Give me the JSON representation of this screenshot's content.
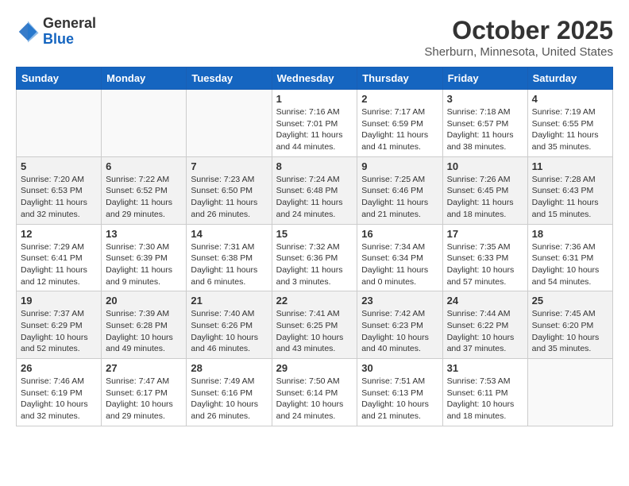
{
  "header": {
    "logo_general": "General",
    "logo_blue": "Blue",
    "month_title": "October 2025",
    "location": "Sherburn, Minnesota, United States"
  },
  "days_of_week": [
    "Sunday",
    "Monday",
    "Tuesday",
    "Wednesday",
    "Thursday",
    "Friday",
    "Saturday"
  ],
  "weeks": [
    [
      {
        "day": "",
        "info": ""
      },
      {
        "day": "",
        "info": ""
      },
      {
        "day": "",
        "info": ""
      },
      {
        "day": "1",
        "info": "Sunrise: 7:16 AM\nSunset: 7:01 PM\nDaylight: 11 hours and 44 minutes."
      },
      {
        "day": "2",
        "info": "Sunrise: 7:17 AM\nSunset: 6:59 PM\nDaylight: 11 hours and 41 minutes."
      },
      {
        "day": "3",
        "info": "Sunrise: 7:18 AM\nSunset: 6:57 PM\nDaylight: 11 hours and 38 minutes."
      },
      {
        "day": "4",
        "info": "Sunrise: 7:19 AM\nSunset: 6:55 PM\nDaylight: 11 hours and 35 minutes."
      }
    ],
    [
      {
        "day": "5",
        "info": "Sunrise: 7:20 AM\nSunset: 6:53 PM\nDaylight: 11 hours and 32 minutes."
      },
      {
        "day": "6",
        "info": "Sunrise: 7:22 AM\nSunset: 6:52 PM\nDaylight: 11 hours and 29 minutes."
      },
      {
        "day": "7",
        "info": "Sunrise: 7:23 AM\nSunset: 6:50 PM\nDaylight: 11 hours and 26 minutes."
      },
      {
        "day": "8",
        "info": "Sunrise: 7:24 AM\nSunset: 6:48 PM\nDaylight: 11 hours and 24 minutes."
      },
      {
        "day": "9",
        "info": "Sunrise: 7:25 AM\nSunset: 6:46 PM\nDaylight: 11 hours and 21 minutes."
      },
      {
        "day": "10",
        "info": "Sunrise: 7:26 AM\nSunset: 6:45 PM\nDaylight: 11 hours and 18 minutes."
      },
      {
        "day": "11",
        "info": "Sunrise: 7:28 AM\nSunset: 6:43 PM\nDaylight: 11 hours and 15 minutes."
      }
    ],
    [
      {
        "day": "12",
        "info": "Sunrise: 7:29 AM\nSunset: 6:41 PM\nDaylight: 11 hours and 12 minutes."
      },
      {
        "day": "13",
        "info": "Sunrise: 7:30 AM\nSunset: 6:39 PM\nDaylight: 11 hours and 9 minutes."
      },
      {
        "day": "14",
        "info": "Sunrise: 7:31 AM\nSunset: 6:38 PM\nDaylight: 11 hours and 6 minutes."
      },
      {
        "day": "15",
        "info": "Sunrise: 7:32 AM\nSunset: 6:36 PM\nDaylight: 11 hours and 3 minutes."
      },
      {
        "day": "16",
        "info": "Sunrise: 7:34 AM\nSunset: 6:34 PM\nDaylight: 11 hours and 0 minutes."
      },
      {
        "day": "17",
        "info": "Sunrise: 7:35 AM\nSunset: 6:33 PM\nDaylight: 10 hours and 57 minutes."
      },
      {
        "day": "18",
        "info": "Sunrise: 7:36 AM\nSunset: 6:31 PM\nDaylight: 10 hours and 54 minutes."
      }
    ],
    [
      {
        "day": "19",
        "info": "Sunrise: 7:37 AM\nSunset: 6:29 PM\nDaylight: 10 hours and 52 minutes."
      },
      {
        "day": "20",
        "info": "Sunrise: 7:39 AM\nSunset: 6:28 PM\nDaylight: 10 hours and 49 minutes."
      },
      {
        "day": "21",
        "info": "Sunrise: 7:40 AM\nSunset: 6:26 PM\nDaylight: 10 hours and 46 minutes."
      },
      {
        "day": "22",
        "info": "Sunrise: 7:41 AM\nSunset: 6:25 PM\nDaylight: 10 hours and 43 minutes."
      },
      {
        "day": "23",
        "info": "Sunrise: 7:42 AM\nSunset: 6:23 PM\nDaylight: 10 hours and 40 minutes."
      },
      {
        "day": "24",
        "info": "Sunrise: 7:44 AM\nSunset: 6:22 PM\nDaylight: 10 hours and 37 minutes."
      },
      {
        "day": "25",
        "info": "Sunrise: 7:45 AM\nSunset: 6:20 PM\nDaylight: 10 hours and 35 minutes."
      }
    ],
    [
      {
        "day": "26",
        "info": "Sunrise: 7:46 AM\nSunset: 6:19 PM\nDaylight: 10 hours and 32 minutes."
      },
      {
        "day": "27",
        "info": "Sunrise: 7:47 AM\nSunset: 6:17 PM\nDaylight: 10 hours and 29 minutes."
      },
      {
        "day": "28",
        "info": "Sunrise: 7:49 AM\nSunset: 6:16 PM\nDaylight: 10 hours and 26 minutes."
      },
      {
        "day": "29",
        "info": "Sunrise: 7:50 AM\nSunset: 6:14 PM\nDaylight: 10 hours and 24 minutes."
      },
      {
        "day": "30",
        "info": "Sunrise: 7:51 AM\nSunset: 6:13 PM\nDaylight: 10 hours and 21 minutes."
      },
      {
        "day": "31",
        "info": "Sunrise: 7:53 AM\nSunset: 6:11 PM\nDaylight: 10 hours and 18 minutes."
      },
      {
        "day": "",
        "info": ""
      }
    ]
  ]
}
